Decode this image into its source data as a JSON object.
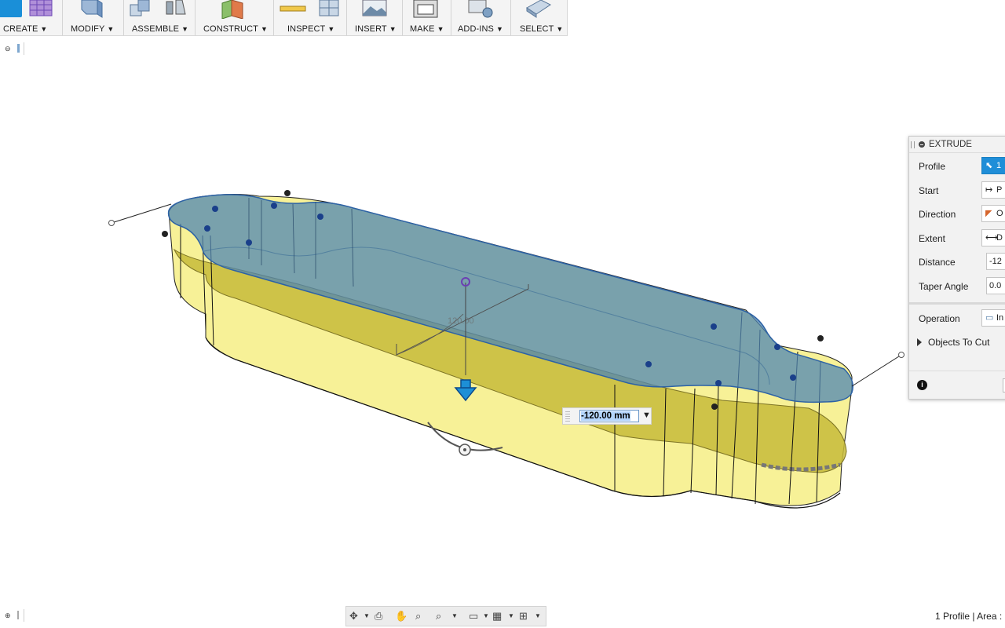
{
  "toolbar": {
    "groups": [
      {
        "label": "CREATE",
        "icon": "create-icons"
      },
      {
        "label": "MODIFY",
        "icon": "modify-icon"
      },
      {
        "label": "ASSEMBLE",
        "icon": "assemble-icons"
      },
      {
        "label": "CONSTRUCT",
        "icon": "construct-icon"
      },
      {
        "label": "INSPECT",
        "icon": "inspect-icons"
      },
      {
        "label": "INSERT",
        "icon": "insert-image-icon"
      },
      {
        "label": "MAKE",
        "icon": "make-3dprint-icon"
      },
      {
        "label": "ADD-INS",
        "icon": "addins-icon"
      },
      {
        "label": "SELECT",
        "icon": "select-icon"
      }
    ],
    "caret": "▼"
  },
  "viewport": {
    "distance_value": "-120.00 mm",
    "dimension_ghost": "120.00",
    "colors": {
      "profile_blue": "#4f86b3",
      "extrude_yellow": "#f5ee8a",
      "arrow_blue": "#1d8fd6"
    }
  },
  "extrude_panel": {
    "title": "EXTRUDE",
    "rows": [
      {
        "label": "Profile",
        "value": "1",
        "icon": "cursor-select-icon"
      },
      {
        "label": "Start",
        "value": "P",
        "icon": "start-plane-icon"
      },
      {
        "label": "Direction",
        "value": "O",
        "icon": "direction-icon"
      },
      {
        "label": "Extent",
        "value": "D",
        "icon": "extent-distance-icon"
      },
      {
        "label": "Distance",
        "value": "-12"
      },
      {
        "label": "Taper Angle",
        "value": "0.0"
      }
    ],
    "operation": {
      "label": "Operation",
      "value": "In",
      "icon": "operation-icon"
    },
    "objects_to_cut": "Objects To Cut",
    "info": "i"
  },
  "statusbar": {
    "text": "1 Profile | Area :"
  }
}
